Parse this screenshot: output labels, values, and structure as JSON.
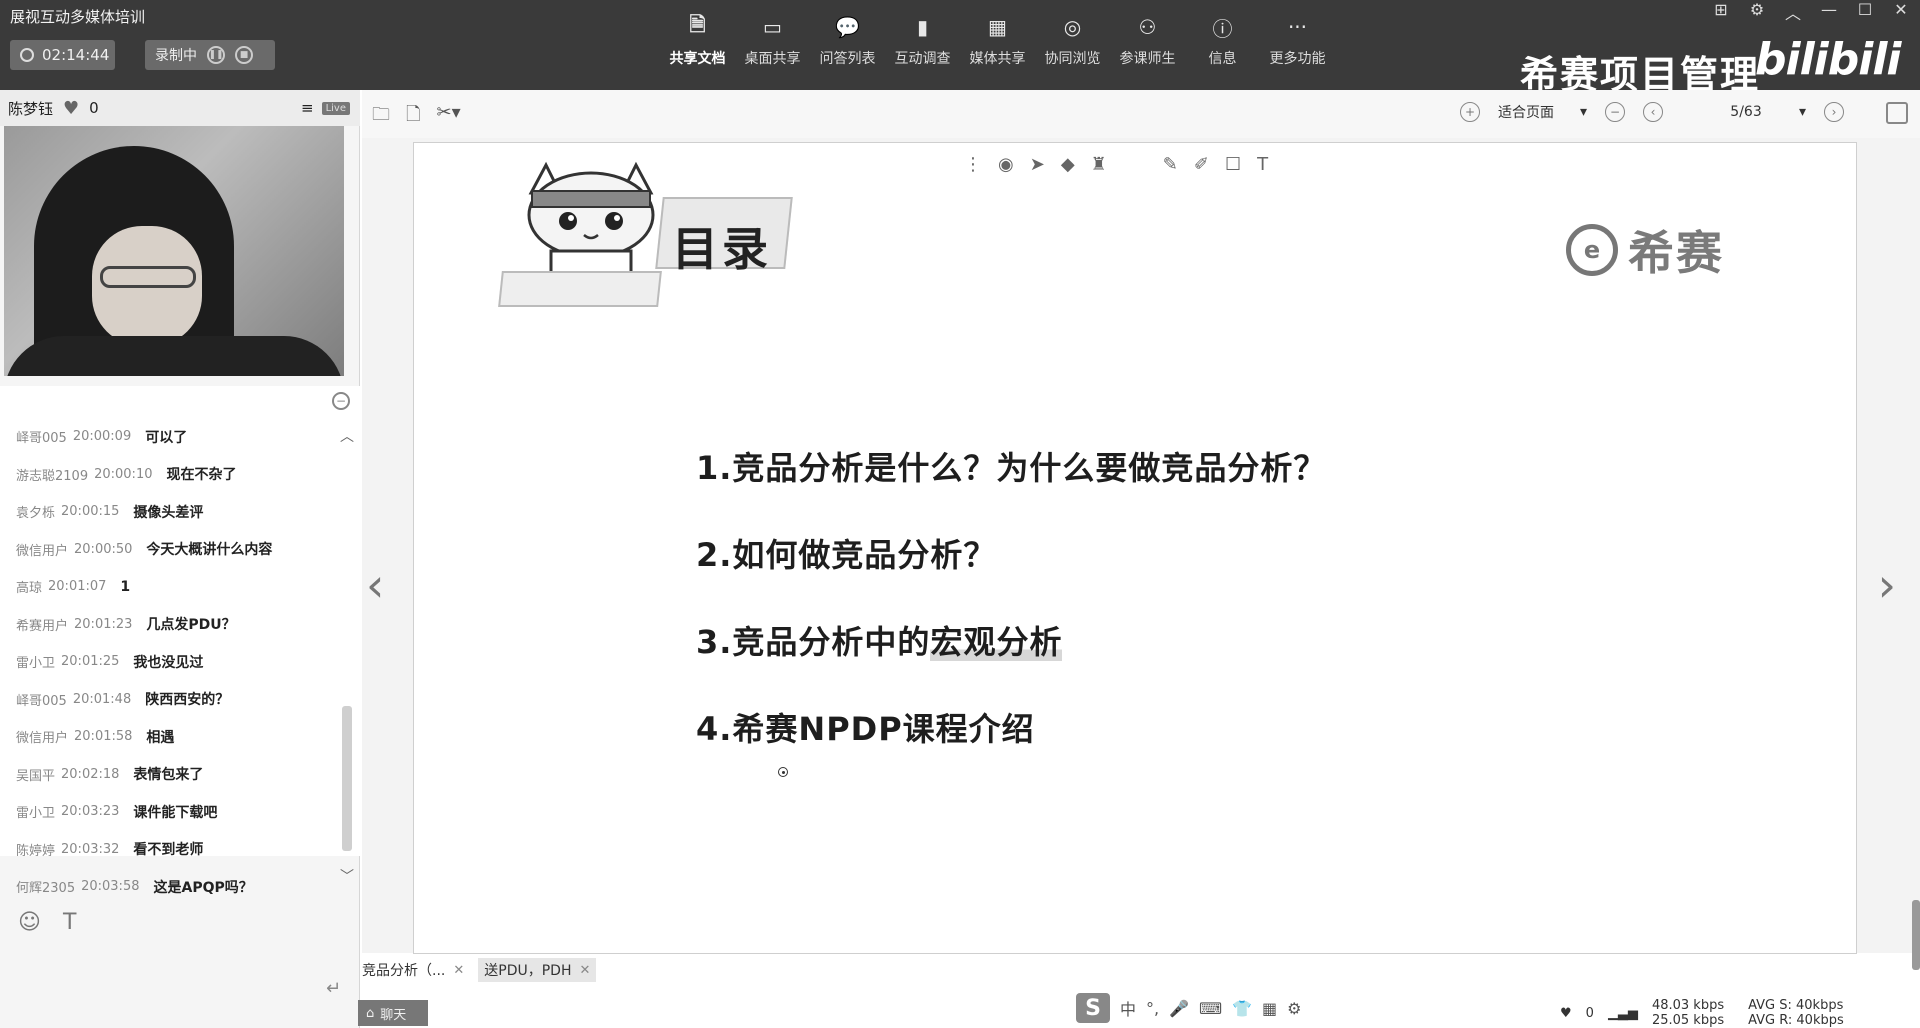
{
  "app": {
    "title": "展视互动多媒体培训",
    "timer": "02:14:44",
    "recording_label": "录制中",
    "brand": "希赛项目管理",
    "bili": "bilibili"
  },
  "nav": {
    "items": [
      {
        "label": "共享文档",
        "icon": "document-icon"
      },
      {
        "label": "桌面共享",
        "icon": "monitor-icon"
      },
      {
        "label": "问答列表",
        "icon": "chat-bubbles-icon"
      },
      {
        "label": "互动调查",
        "icon": "bar-chart-icon"
      },
      {
        "label": "媒体共享",
        "icon": "film-icon"
      },
      {
        "label": "协同浏览",
        "icon": "compass-icon"
      },
      {
        "label": "参课师生",
        "icon": "people-icon"
      },
      {
        "label": "信息",
        "icon": "info-icon"
      },
      {
        "label": "更多功能",
        "icon": "more-icon"
      }
    ],
    "active": "共享文档"
  },
  "presenter": {
    "name": "陈梦钰",
    "likes": "0",
    "badge": "Live"
  },
  "chat": {
    "messages": [
      {
        "user": "峄哥005",
        "time": "20:00:09",
        "text": "可以了"
      },
      {
        "user": "游志聪2109",
        "time": "20:00:10",
        "text": "现在不杂了"
      },
      {
        "user": "袁夕栎",
        "time": "20:00:15",
        "text": "摄像头差评"
      },
      {
        "user": "微信用户",
        "time": "20:00:50",
        "text": "今天大概讲什么内容"
      },
      {
        "user": "高琼",
        "time": "20:01:07",
        "text": "1"
      },
      {
        "user": "希赛用户",
        "time": "20:01:23",
        "text": "几点发PDU？"
      },
      {
        "user": "雷小卫",
        "time": "20:01:25",
        "text": "我也没见过"
      },
      {
        "user": "峄哥005",
        "time": "20:01:48",
        "text": "陕西西安的？"
      },
      {
        "user": "微信用户",
        "time": "20:01:58",
        "text": "相遇"
      },
      {
        "user": "吴国平",
        "time": "20:02:18",
        "text": "表情包来了"
      },
      {
        "user": "雷小卫",
        "time": "20:03:23",
        "text": "课件能下载吧"
      },
      {
        "user": "陈婷婷",
        "time": "20:03:32",
        "text": "看不到老师"
      },
      {
        "user": "何辉2305",
        "time": "20:03:58",
        "text": "这是APQP吗？"
      }
    ]
  },
  "doc_toolbar": {
    "zoom_label": "适合页面",
    "page": "5/63"
  },
  "slide": {
    "title": "目录",
    "logo_text": "希赛",
    "items": [
      {
        "plain": "1.竞品分析是什么？为什么要做竞品分析？",
        "highlight": ""
      },
      {
        "plain": "2.如何做竞品分析？",
        "highlight": ""
      },
      {
        "plain": "3.竞品分析中的",
        "highlight": "宏观分析"
      },
      {
        "plain": "4.希赛NPDP课程介绍",
        "highlight": ""
      }
    ]
  },
  "bottom": {
    "tab1": "竞品分析（...",
    "tab2": "送PDU，PDH",
    "chat_tab": "聊天",
    "likes": "0",
    "up_rate": "48.03 kbps",
    "down_rate": "25.05 kbps",
    "avg_s": "AVG S: 40kbps",
    "avg_r": "AVG R: 40kbps"
  }
}
